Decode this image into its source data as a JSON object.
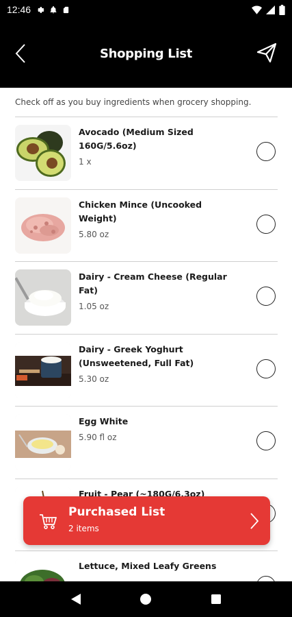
{
  "status_bar": {
    "time": "12:46"
  },
  "header": {
    "title": "Shopping List"
  },
  "instructions": "Check off as you buy ingredients when grocery shopping.",
  "items": [
    {
      "name": "Avocado (Medium Sized 160G/5.6oz)",
      "qty": "1 x",
      "icon": "avocado"
    },
    {
      "name": "Chicken Mince (Uncooked Weight)",
      "qty": "5.80 oz",
      "icon": "chicken-mince"
    },
    {
      "name": "Dairy - Cream Cheese (Regular Fat)",
      "qty": "1.05 oz",
      "icon": "cream-cheese"
    },
    {
      "name": "Dairy - Greek Yoghurt (Unsweetened, Full Fat)",
      "qty": "5.30 oz",
      "icon": "greek-yoghurt"
    },
    {
      "name": "Egg White",
      "qty": "5.90 fl oz",
      "icon": "egg-white"
    },
    {
      "name": "Fruit - Pear (~180G/6.3oz)",
      "qty": "",
      "icon": "pear"
    },
    {
      "name": "Lettuce, Mixed Leafy Greens",
      "qty": "",
      "icon": "lettuce"
    }
  ],
  "purchased": {
    "title": "Purchased List",
    "count": "2 items"
  },
  "colors": {
    "accent": "#e53935",
    "header_bg": "#000000"
  }
}
